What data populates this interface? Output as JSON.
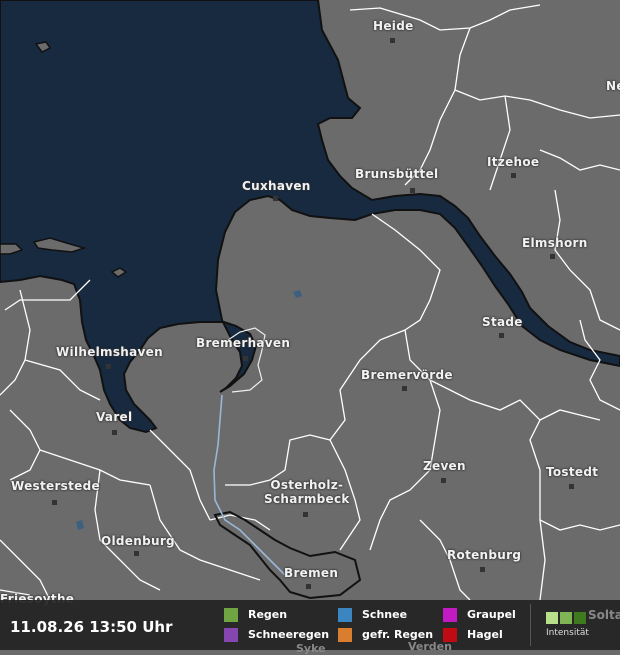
{
  "colors": {
    "sea": "#172a40",
    "land": "#6b6b6b",
    "coast": "#111111",
    "border": "#ffffff",
    "river": "#9ab6d6"
  },
  "cities": [
    {
      "name": "Heide"
    },
    {
      "name": "Cuxhaven"
    },
    {
      "name": "Brunsbüttel"
    },
    {
      "name": "Itzehoe"
    },
    {
      "name": "Elmshorn"
    },
    {
      "name": "Ne"
    },
    {
      "name": "Stade"
    },
    {
      "name": "Bremerhaven"
    },
    {
      "name": "Wilhelmshaven"
    },
    {
      "name": "Bremervörde"
    },
    {
      "name": "Varel"
    },
    {
      "name": "Zeven"
    },
    {
      "name": "Tostedt"
    },
    {
      "name": "Osterholz-\nScharmbeck"
    },
    {
      "name": "Westerstede"
    },
    {
      "name": "Oldenburg"
    },
    {
      "name": "Rotenburg"
    },
    {
      "name": "Bremen"
    },
    {
      "name": "Friesoythe"
    }
  ],
  "footer": {
    "timestamp": "11.08.26 13:50 Uhr",
    "legend": [
      {
        "label": "Regen",
        "color": "#6fa442"
      },
      {
        "label": "Schnee",
        "color": "#3b86c0"
      },
      {
        "label": "Graupel",
        "color": "#c21bc4"
      },
      {
        "label": "Schneeregen",
        "color": "#8646b0"
      },
      {
        "label": "gefr. Regen",
        "color": "#d97e2e"
      },
      {
        "label": "Hagel",
        "color": "#c00a14"
      }
    ],
    "intensity": {
      "label": "Intensität",
      "colors": [
        "#b8e08a",
        "#7fb554",
        "#3f7a1e"
      ]
    },
    "cutoff_labels": [
      "Solta",
      "Verden",
      "Syke"
    ]
  }
}
